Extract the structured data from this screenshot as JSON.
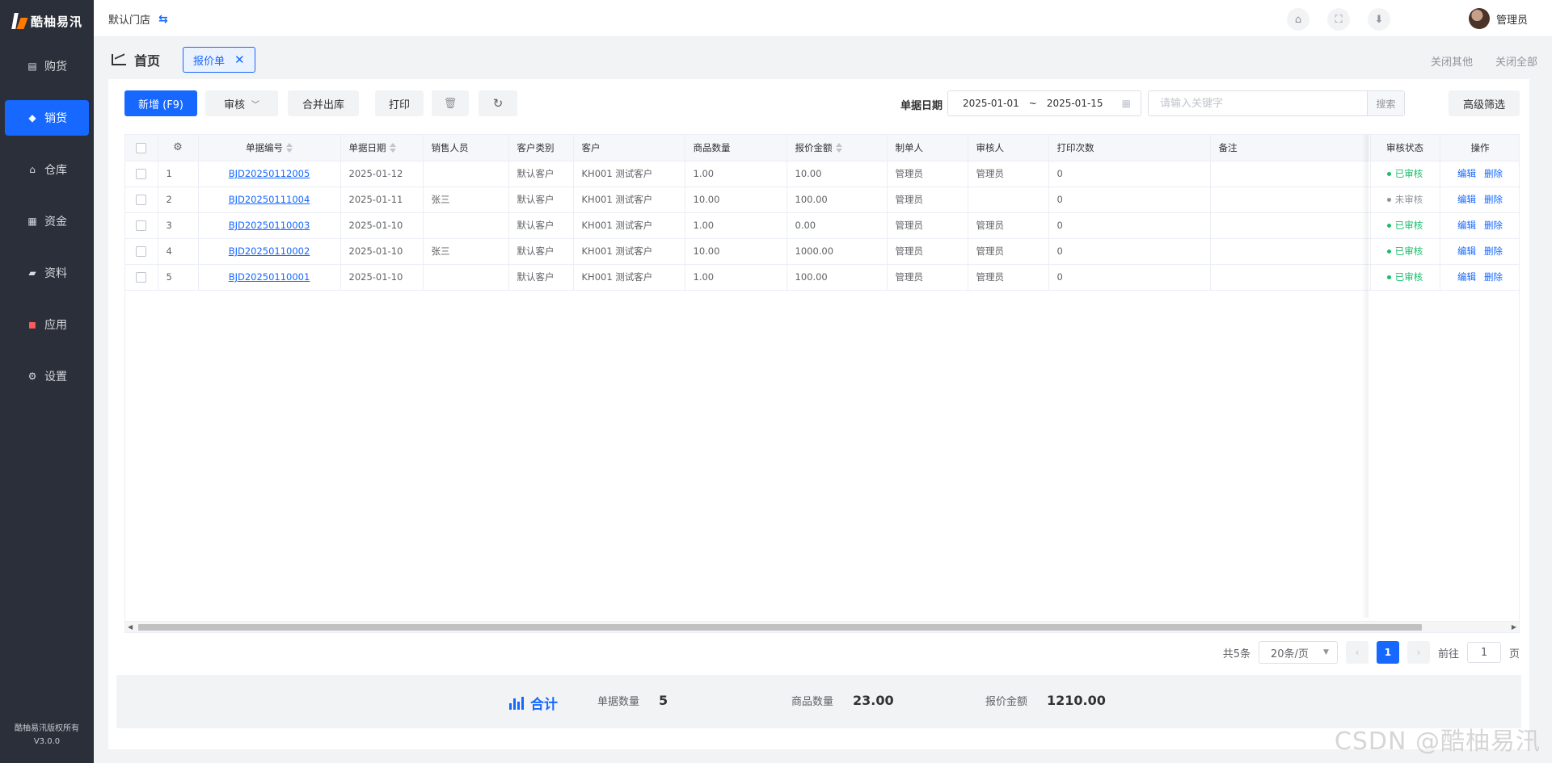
{
  "sidebar": {
    "logo_text": "酷柚易汛",
    "items": [
      {
        "label": "购货",
        "icon": "list-icon",
        "active": false
      },
      {
        "label": "销货",
        "icon": "tag-icon",
        "active": true
      },
      {
        "label": "仓库",
        "icon": "home-icon",
        "active": false
      },
      {
        "label": "资金",
        "icon": "grid-icon",
        "active": false
      },
      {
        "label": "资料",
        "icon": "truck-icon",
        "active": false
      },
      {
        "label": "应用",
        "icon": "apps-icon",
        "active": false
      },
      {
        "label": "设置",
        "icon": "gear-icon",
        "active": false
      }
    ],
    "copyright": "酷柚易汛版权所有",
    "version": "V3.0.0"
  },
  "topbar": {
    "store": "默认门店",
    "user": "管理员"
  },
  "tabs": {
    "home": "首页",
    "current": "报价单",
    "close_others": "关闭其他",
    "close_all": "关闭全部"
  },
  "toolbar": {
    "add": "新增 (F9)",
    "audit": "审核",
    "merge": "合并出库",
    "print": "打印",
    "date_label": "单据日期",
    "date_from": "2025-01-01",
    "date_sep": "~",
    "date_to": "2025-01-15",
    "search_placeholder": "请输入关键字",
    "search_btn": "搜索",
    "advanced": "高级筛选"
  },
  "table": {
    "columns": [
      "单据编号",
      "单据日期",
      "销售人员",
      "客户类别",
      "客户",
      "商品数量",
      "报价金额",
      "制单人",
      "审核人",
      "打印次数",
      "备注",
      "审核状态",
      "操作"
    ],
    "rows": [
      {
        "idx": "1",
        "no": "BJD20250112005",
        "date": "2025-01-12",
        "sales": "",
        "ctype": "默认客户",
        "customer": "KH001 测试客户",
        "qty": "1.00",
        "amount": "10.00",
        "maker": "管理员",
        "auditor": "管理员",
        "prints": "0",
        "remark": "",
        "status": "已审核",
        "status_color": "#19be6b"
      },
      {
        "idx": "2",
        "no": "BJD20250111004",
        "date": "2025-01-11",
        "sales": "张三",
        "ctype": "默认客户",
        "customer": "KH001 测试客户",
        "qty": "10.00",
        "amount": "100.00",
        "maker": "管理员",
        "auditor": "",
        "prints": "0",
        "remark": "",
        "status": "未审核",
        "status_color": "#909399"
      },
      {
        "idx": "3",
        "no": "BJD20250110003",
        "date": "2025-01-10",
        "sales": "",
        "ctype": "默认客户",
        "customer": "KH001 测试客户",
        "qty": "1.00",
        "amount": "0.00",
        "maker": "管理员",
        "auditor": "管理员",
        "prints": "0",
        "remark": "",
        "status": "已审核",
        "status_color": "#19be6b"
      },
      {
        "idx": "4",
        "no": "BJD20250110002",
        "date": "2025-01-10",
        "sales": "张三",
        "ctype": "默认客户",
        "customer": "KH001 测试客户",
        "qty": "10.00",
        "amount": "1000.00",
        "maker": "管理员",
        "auditor": "管理员",
        "prints": "0",
        "remark": "",
        "status": "已审核",
        "status_color": "#19be6b"
      },
      {
        "idx": "5",
        "no": "BJD20250110001",
        "date": "2025-01-10",
        "sales": "",
        "ctype": "默认客户",
        "customer": "KH001 测试客户",
        "qty": "1.00",
        "amount": "100.00",
        "maker": "管理员",
        "auditor": "管理员",
        "prints": "0",
        "remark": "",
        "status": "已审核",
        "status_color": "#19be6b"
      }
    ],
    "op_edit": "编辑",
    "op_delete": "删除"
  },
  "pagination": {
    "total": "共5条",
    "page_size": "20条/页",
    "current": "1",
    "goto_label": "前往",
    "goto_value": "1",
    "page_unit": "页"
  },
  "summary": {
    "title": "合计",
    "doc_count_label": "单据数量",
    "doc_count": "5",
    "qty_label": "商品数量",
    "qty": "23.00",
    "amount_label": "报价金额",
    "amount": "1210.00"
  },
  "watermark": "CSDN @酷柚易汛",
  "colors": {
    "primary": "#1668ff",
    "sidebar_bg": "#2b2f3a",
    "approved": "#19be6b",
    "pending": "#909399"
  }
}
